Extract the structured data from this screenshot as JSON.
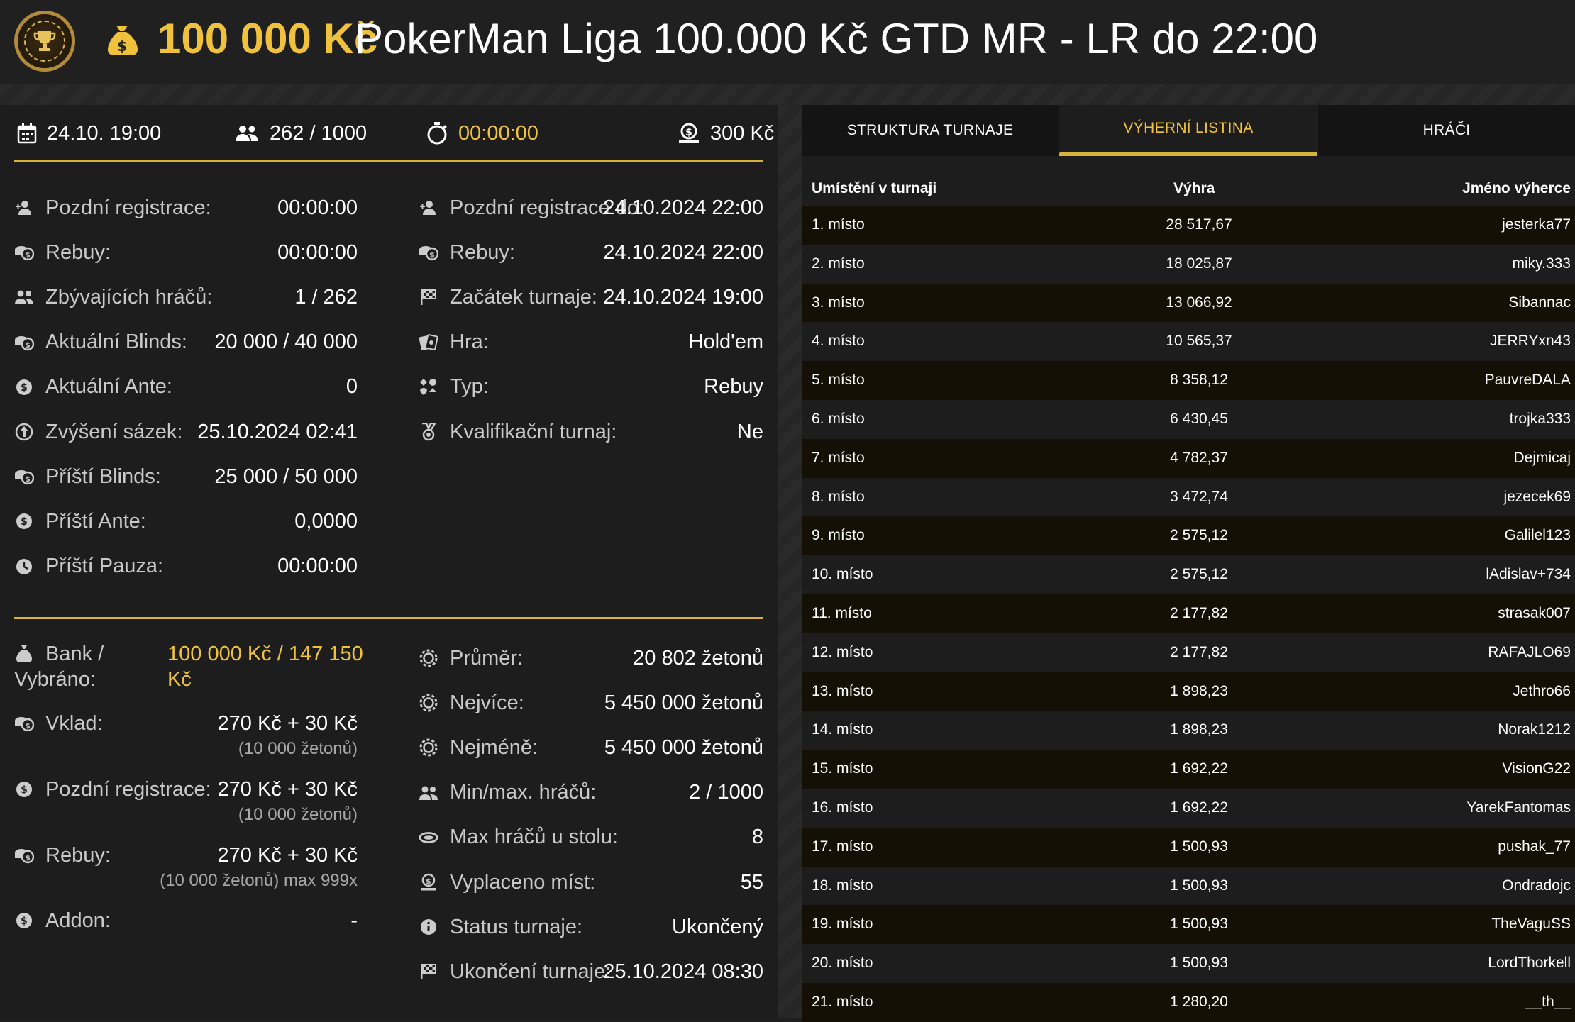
{
  "header": {
    "amount": "100 000 Kč",
    "name": "PokerMan Liga 100.000 Kč GTD MR - LR do 22:00"
  },
  "topbar": {
    "date": "24.10. 19:00",
    "players": "262 / 1000",
    "timer": "00:00:00",
    "buyin": "300 Kč"
  },
  "info_left": [
    {
      "icon": "person-add-icon",
      "label": "Pozdní registrace:",
      "value": "00:00:00"
    },
    {
      "icon": "coins-icon",
      "label": "Rebuy:",
      "value": "00:00:00"
    },
    {
      "icon": "people-icon",
      "label": "Zbývajících hráčů:",
      "value": "1 / 262"
    },
    {
      "icon": "coins-icon",
      "label": "Aktuální Blinds:",
      "value": "20 000 / 40 000"
    },
    {
      "icon": "dollar-circle-icon",
      "label": "Aktuální Ante:",
      "value": "0"
    },
    {
      "icon": "speed-up-icon",
      "label": "Zvýšení sázek:",
      "value": "25.10.2024 02:41"
    },
    {
      "icon": "coins-icon",
      "label": "Příští Blinds:",
      "value": "25 000 / 50 000"
    },
    {
      "icon": "dollar-circle-icon",
      "label": "Příští Ante:",
      "value": "0,0000"
    },
    {
      "icon": "clock-icon",
      "label": "Příští Pauza:",
      "value": "00:00:00"
    }
  ],
  "info_right": [
    {
      "icon": "person-add-icon",
      "label": "Pozdní registrace do:",
      "value": "24.10.2024 22:00"
    },
    {
      "icon": "coins-icon",
      "label": "Rebuy:",
      "value": "24.10.2024 22:00"
    },
    {
      "icon": "flag-icon",
      "label": "Začátek turnaje:",
      "value": "24.10.2024 19:00"
    },
    {
      "icon": "cards-icon",
      "label": "Hra:",
      "value": "Hold'em"
    },
    {
      "icon": "suits-icon",
      "label": "Typ:",
      "value": "Rebuy"
    },
    {
      "icon": "medal-icon",
      "label": "Kvalifikační turnaj:",
      "value": "Ne"
    }
  ],
  "money_left": {
    "bank_label": "Bank /",
    "bank_label2": "Vybráno:",
    "bank_value": "100 000 Kč / 147 150",
    "bank_value2": "Kč",
    "vklad_label": "Vklad:",
    "vklad_value": "270 Kč + 30 Kč",
    "vklad_sub": "(10 000 žetonů)",
    "late_label": "Pozdní registrace:",
    "late_value": "270 Kč + 30 Kč",
    "late_sub": "(10 000 žetonů)",
    "rebuy_label": "Rebuy:",
    "rebuy_value": "270 Kč + 30 Kč",
    "rebuy_sub": "(10 000 žetonů) max 999x",
    "addon_label": "Addon:",
    "addon_value": "-"
  },
  "money_right": [
    {
      "icon": "chip-icon",
      "label": "Průměr:",
      "value": "20 802 žetonů"
    },
    {
      "icon": "chip-icon",
      "label": "Nejvíce:",
      "value": "5 450 000 žetonů"
    },
    {
      "icon": "chip-icon",
      "label": "Nejméně:",
      "value": "5 450 000 žetonů"
    },
    {
      "icon": "people-icon",
      "label": "Min/max. hráčů:",
      "value": "2 / 1000"
    },
    {
      "icon": "table-icon",
      "label": "Max hráčů u stolu:",
      "value": "8"
    },
    {
      "icon": "payout-icon",
      "label": "Vyplaceno míst:",
      "value": "55"
    },
    {
      "icon": "info-icon",
      "label": "Status turnaje:",
      "value": "Ukončený"
    },
    {
      "icon": "flag-icon",
      "label": "Ukončení turnaje:",
      "value": "25.10.2024 08:30"
    }
  ],
  "tabs": [
    "STRUKTURA TURNAJE",
    "VÝHERNÍ LISTINA",
    "HRÁČI"
  ],
  "table": {
    "headers": [
      "Umístění v turnaji",
      "Výhra",
      "Jméno výherce"
    ],
    "rows": [
      [
        "1. místo",
        "28 517,67",
        "jesterka77"
      ],
      [
        "2. místo",
        "18 025,87",
        "miky.333"
      ],
      [
        "3. místo",
        "13 066,92",
        "Sibannac"
      ],
      [
        "4. místo",
        "10 565,37",
        "JERRYxn43"
      ],
      [
        "5. místo",
        "8 358,12",
        "PauvreDALA"
      ],
      [
        "6. místo",
        "6 430,45",
        "trojka333"
      ],
      [
        "7. místo",
        "4 782,37",
        "Dejmicaj"
      ],
      [
        "8. místo",
        "3 472,74",
        "jezecek69"
      ],
      [
        "9. místo",
        "2 575,12",
        "Galilel123"
      ],
      [
        "10. místo",
        "2 575,12",
        "lAdislav+734"
      ],
      [
        "11. místo",
        "2 177,82",
        "strasak007"
      ],
      [
        "12. místo",
        "2 177,82",
        "RAFAJLO69"
      ],
      [
        "13. místo",
        "1 898,23",
        "Jethro66"
      ],
      [
        "14. místo",
        "1 898,23",
        "Norak1212"
      ],
      [
        "15. místo",
        "1 692,22",
        "VisionG22"
      ],
      [
        "16. místo",
        "1 692,22",
        "YarekFantomas"
      ],
      [
        "17. místo",
        "1 500,93",
        "pushak_77"
      ],
      [
        "18. místo",
        "1 500,93",
        "Ondradojc"
      ],
      [
        "19. místo",
        "1 500,93",
        "TheVaguSS"
      ],
      [
        "20. místo",
        "1 500,93",
        "LordThorkell"
      ],
      [
        "21. místo",
        "1 280,20",
        "__th__"
      ]
    ]
  },
  "colors": {
    "accent": "#f0c23c",
    "rule": "#d7b23c",
    "bg": "#1d1d1d",
    "row_odd": "#141006"
  }
}
